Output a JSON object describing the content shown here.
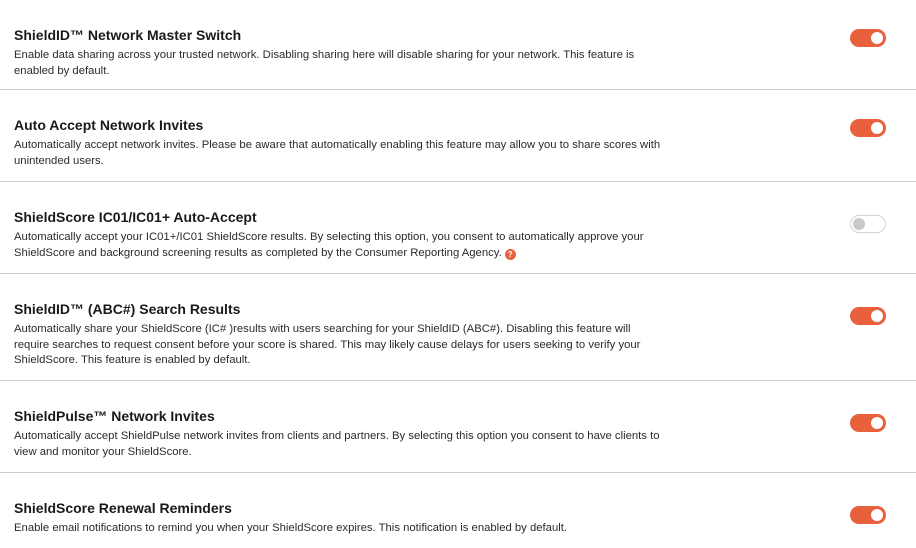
{
  "colors": {
    "accent": "#e8603c",
    "divider": "#cfcfcf",
    "toggle_off_knob": "#c9c9c9"
  },
  "settings": [
    {
      "title": "ShieldID™ Network Master Switch",
      "description": "Enable data sharing across your trusted network. Disabling sharing here will disable sharing for your network. This feature is enabled by default.",
      "enabled": true
    },
    {
      "title": "Auto Accept Network Invites",
      "description": "Automatically accept network invites. Please be aware that automatically enabling this feature may allow you to share scores with unintended users.",
      "enabled": true
    },
    {
      "title": "ShieldScore IC01/IC01+ Auto-Accept",
      "description": "Automatically accept your IC01+/IC01 ShieldScore results. By selecting this option, you consent to automatically approve your ShieldScore and background screening results as completed by the Consumer Reporting Agency.",
      "help_icon": "question-icon",
      "help_glyph": "?",
      "enabled": false
    },
    {
      "title": "ShieldID™ (ABC#) Search Results",
      "description": "Automatically share your ShieldScore (IC# )results with users searching for your ShieldID (ABC#). Disabling this feature will require searches to request consent before your score is shared. This may likely cause delays for users seeking to verify your ShieldScore. This feature is enabled by default.",
      "enabled": true
    },
    {
      "title": "ShieldPulse™ Network Invites",
      "description": "Automatically accept ShieldPulse network invites from clients and partners. By selecting this option you consent to have clients to view and monitor your ShieldScore.",
      "enabled": true
    },
    {
      "title": "ShieldScore Renewal Reminders",
      "description": "Enable email notifications to remind you when your ShieldScore expires. This notification is enabled by default.",
      "enabled": true
    }
  ]
}
